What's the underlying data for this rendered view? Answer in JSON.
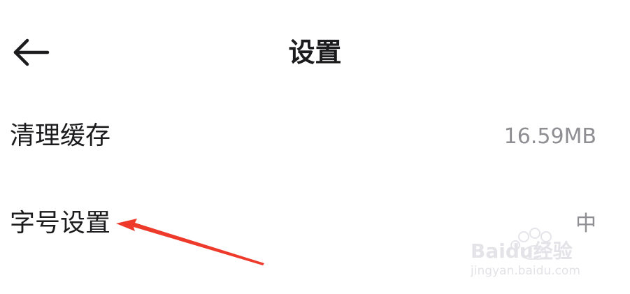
{
  "header": {
    "title": "设置",
    "back_icon": "arrow-left-icon"
  },
  "settings": {
    "items": [
      {
        "label": "清理缓存",
        "value": "16.59MB"
      },
      {
        "label": "字号设置",
        "value": "中"
      }
    ]
  },
  "annotation": {
    "color": "#ee3a2b",
    "target": "字号设置"
  },
  "watermark": {
    "text": "Baidu经验",
    "subtext": "jingyan.baidu.com"
  },
  "colors": {
    "primary_text": "#1c1c1e",
    "secondary_text": "#8e8e93",
    "background": "#ffffff"
  }
}
